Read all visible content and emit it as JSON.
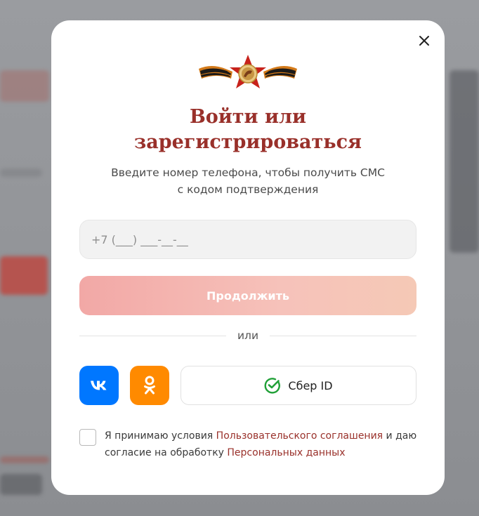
{
  "modal": {
    "title_line1": "Войти или",
    "title_line2": "зарегистрироваться",
    "subtitle_line1": "Введите номер телефона, чтобы получить СМС",
    "subtitle_line2": "с кодом подтверждения",
    "phone_placeholder": "+7 (___) ___-__-__",
    "phone_value": "",
    "continue_label": "Продолжить",
    "divider_label": "или",
    "vk_label": "VK",
    "ok_label": "OK",
    "sber_label": "Сбер ID",
    "agreement": {
      "part1": "Я принимаю условия ",
      "link1": "Пользовательского соглашения",
      "part2": " и даю согласие на обработку ",
      "link2": "Персональных данных",
      "checked": false
    }
  },
  "colors": {
    "accent": "#99302a",
    "continue_disabled": "#f3b0ab",
    "vk": "#0077ff",
    "ok": "#ff8a00",
    "sber": "#21a038"
  },
  "icons": {
    "close": "close-icon",
    "logo": "victory-star-ribbon-logo",
    "vk": "vk-icon",
    "ok": "odnoklassniki-icon",
    "sber": "sber-check-icon"
  }
}
